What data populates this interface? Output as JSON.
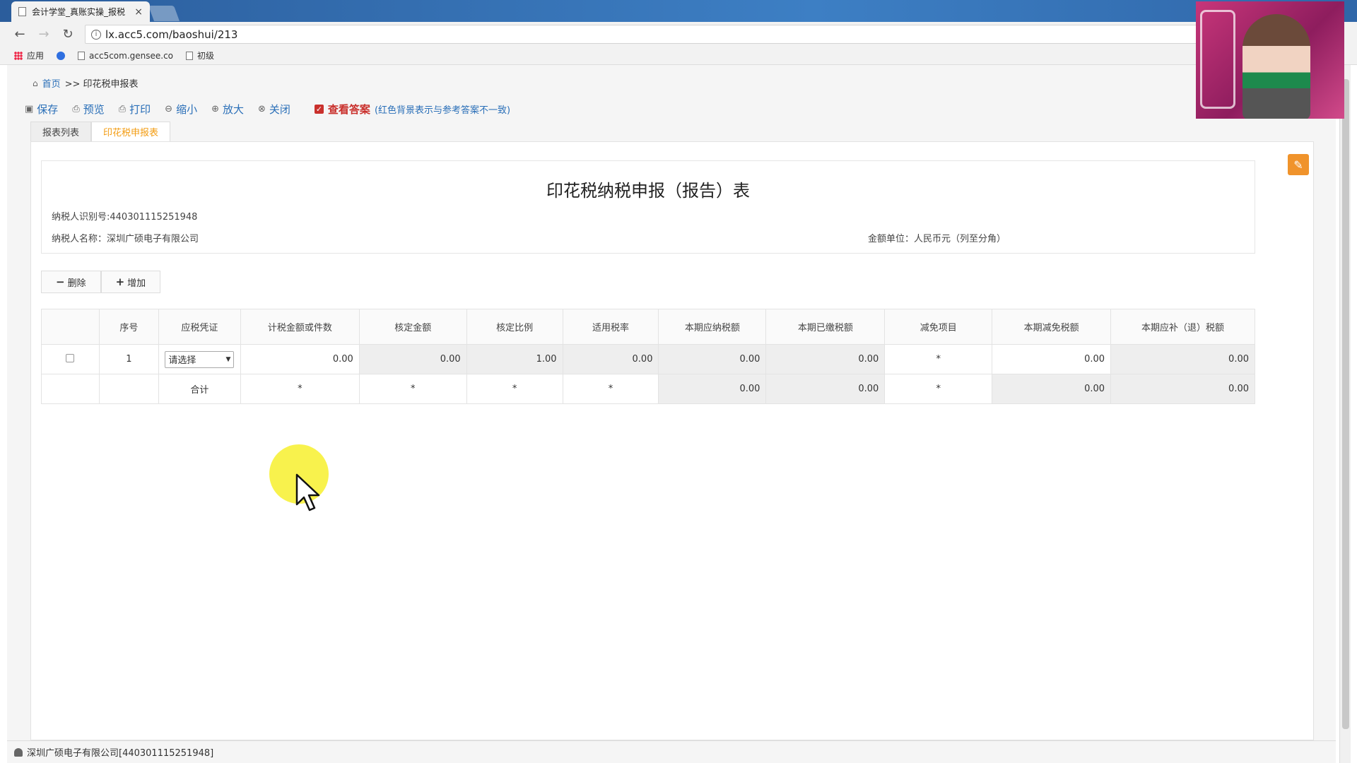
{
  "browser": {
    "tab_title": "会计学堂_真账实操_报税",
    "url": "lx.acc5.com/baoshui/213",
    "bookmarks": [
      {
        "label": "应用",
        "icon": "apps-icon"
      },
      {
        "label": "",
        "icon": "baidu-icon"
      },
      {
        "label": "acc5com.gensee.co",
        "icon": "page-icon"
      },
      {
        "label": "初级",
        "icon": "page-icon"
      }
    ]
  },
  "breadcrumb": {
    "home": "首页",
    "current": ">> 印花税申报表"
  },
  "toolbar": {
    "save": "保存",
    "preview": "预览",
    "print": "打印",
    "zoom_out": "缩小",
    "zoom_in": "放大",
    "close": "关闭",
    "show_answer": "查看答案",
    "answer_note": "(红色背景表示与参考答案不一致)",
    "show_answer_checked": true
  },
  "tabs": [
    {
      "label": "报表列表",
      "active": false
    },
    {
      "label": "印花税申报表",
      "active": true
    }
  ],
  "report": {
    "title": "印花税纳税申报（报告）表",
    "taxpayer_id": "纳税人识别号:440301115251948",
    "taxpayer_name": "纳税人名称：深圳广硕电子有限公司",
    "unit": "金额单位：人民币元（列至分角）"
  },
  "row_buttons": {
    "delete": "删除",
    "add": "增加"
  },
  "table": {
    "headers": [
      "",
      "序号",
      "应税凭证",
      "计税金额或件数",
      "核定金额",
      "核定比例",
      "适用税率",
      "本期应纳税额",
      "本期已缴税额",
      "减免项目",
      "本期减免税额",
      "本期应补（退）税额"
    ],
    "row1": {
      "seq": "1",
      "voucher_select": "请选择",
      "taxable_amount": "0.00",
      "assessed_amount": "0.00",
      "assessed_ratio": "1.00",
      "tax_rate": "0.00",
      "tax_payable": "0.00",
      "tax_paid": "0.00",
      "exemption_item": "*",
      "tax_exempt": "0.00",
      "tax_due": "0.00"
    },
    "total": {
      "label": "合计",
      "taxable_amount": "*",
      "assessed_amount": "*",
      "assessed_ratio": "*",
      "tax_rate": "*",
      "tax_payable": "0.00",
      "tax_paid": "0.00",
      "exemption_item": "*",
      "tax_exempt": "0.00",
      "tax_due": "0.00"
    }
  },
  "status": {
    "user": "深圳广硕电子有限公司[440301115251948]"
  },
  "colors": {
    "accent": "#2a6fb8",
    "active_tab": "#f39c12",
    "answer_red": "#c9302c",
    "edit_button": "#f0932b"
  }
}
